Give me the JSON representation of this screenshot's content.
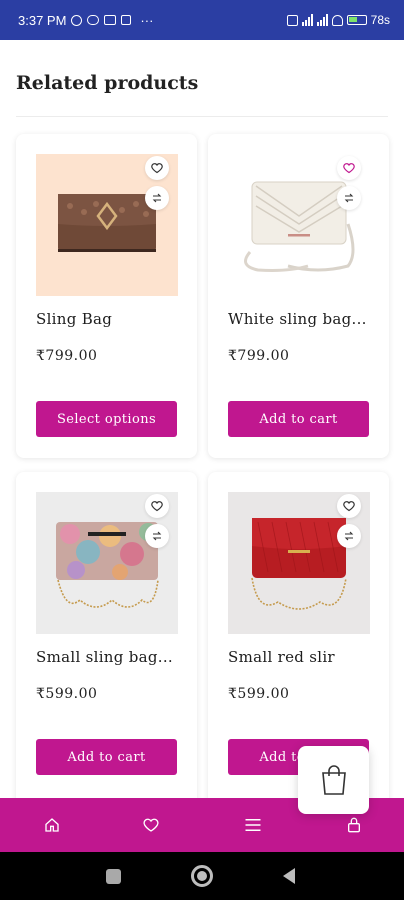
{
  "status_bar": {
    "time": "3:37 PM",
    "battery": "78",
    "battery_suffix": "s",
    "more": "···"
  },
  "section": {
    "title": "Related products"
  },
  "products": [
    {
      "name": "Sling Bag",
      "price": "₹799.00",
      "button": "Select options",
      "wish_active": false,
      "bg": "#fde3cf"
    },
    {
      "name": "White sling bag...",
      "price": "₹799.00",
      "button": "Add to cart",
      "wish_active": true,
      "bg": "#ffffff"
    },
    {
      "name": "Small sling bag...",
      "price": "₹599.00",
      "button": "Add to cart",
      "wish_active": false,
      "bg": "#ececec"
    },
    {
      "name": "Small red slir",
      "price": "₹599.00",
      "button": "Add to cart",
      "wish_active": false,
      "bg": "#e9e7e7"
    }
  ],
  "colors": {
    "accent": "#c0178f",
    "status_bar": "#2b3ea3"
  },
  "bottom_nav": {
    "items": [
      {
        "icon": "home-icon"
      },
      {
        "icon": "heart-icon"
      },
      {
        "icon": "menu-icon"
      },
      {
        "icon": "lock-icon"
      }
    ]
  },
  "floating_cart": {
    "icon": "shopping-bag-icon"
  }
}
